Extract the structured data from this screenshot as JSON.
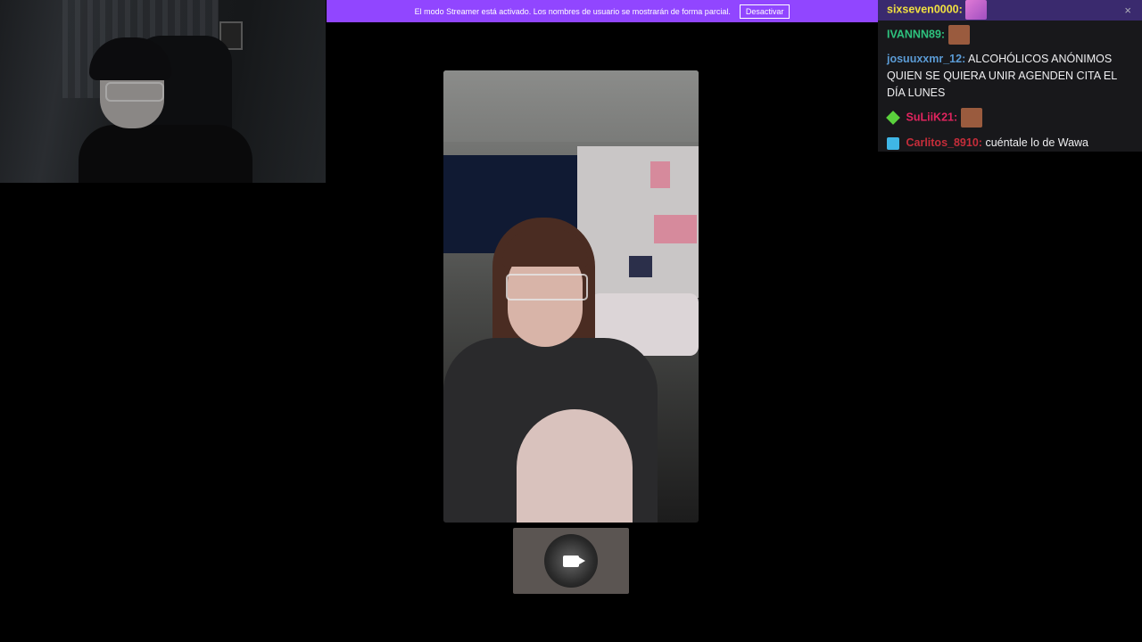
{
  "banner": {
    "text": "El modo Streamer está activado. Los nombres de usuario se mostrarán de forma parcial.",
    "button_label": "Desactivar"
  },
  "chat": {
    "close_icon": "×",
    "messages": [
      {
        "user": "sixseven0000:",
        "text": "",
        "color": "#f0e040",
        "emote": "pink-emote"
      },
      {
        "user": "IVANNN89:",
        "text": "",
        "color": "#2ec27e",
        "emote": "face-emote"
      },
      {
        "user": "josuuxxmr_12:",
        "text": "ALCOHÓLICOS ANÓNIMOS QUIEN SE QUIERA UNIR AGENDEN CITA EL DÍA LUNES",
        "color": "#5b9bd5"
      },
      {
        "user": "SuLiiK21:",
        "text": "",
        "color": "#e0245e",
        "badge": "diamond-badge",
        "emote": "face-emote"
      },
      {
        "user": "Carlitos_8910:",
        "text": "cuéntale lo de Wawa",
        "color": "#c62d3a",
        "badge": "cube-badge"
      }
    ]
  },
  "self_tile": {
    "icon": "video-camera-icon"
  }
}
